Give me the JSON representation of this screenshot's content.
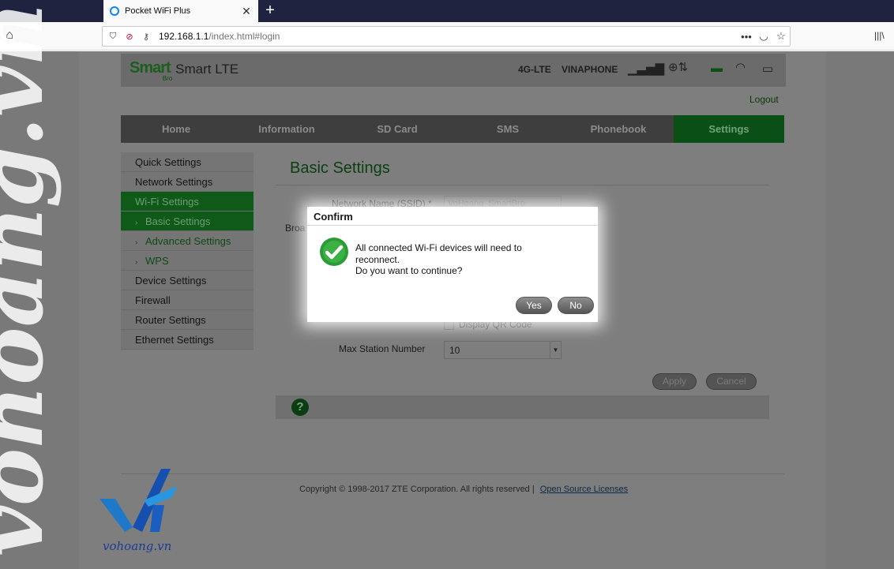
{
  "browser": {
    "tab_title": "Pocket WiFi Plus",
    "new_tab": "+",
    "tab_close": "✕",
    "url_host": "192.168.1.1",
    "url_path": "/index.html#login",
    "page_actions": "•••"
  },
  "header": {
    "brand": "Smart",
    "brand_sub": "Bro",
    "product": "Smart LTE",
    "network_type": "4G-LTE",
    "carrier": "VINAPHONE"
  },
  "logout": "Logout",
  "menu": [
    "Home",
    "Information",
    "SD Card",
    "SMS",
    "Phonebook",
    "Settings"
  ],
  "sidebar": {
    "items": [
      "Quick Settings",
      "Network Settings",
      "Wi-Fi Settings",
      "Basic Settings",
      "Advanced Settings",
      "WPS",
      "Device Settings",
      "Firewall",
      "Router Settings",
      "Ethernet Settings"
    ],
    "sub_marker": "›"
  },
  "content": {
    "title": "Basic Settings",
    "ssid_label": "Network Name (SSID)",
    "required_mark": "*",
    "ssid_value": "VoHoang_SmartBro",
    "broadcast_label_partial": "Broa",
    "qr_label": "Display QR Code",
    "max_station_label": "Max Station Number",
    "max_station_value": "10",
    "apply": "Apply",
    "cancel": "Cancel",
    "help": "?"
  },
  "footer": {
    "copyright": "Copyright © 1998-2017 ZTE Corporation. All rights reserved  |",
    "link": "Open Source Licenses"
  },
  "dialog": {
    "title": "Confirm",
    "line1": "All connected Wi-Fi devices will need to",
    "line2": "reconnect.",
    "line3": "Do you want to continue?",
    "yes": "Yes",
    "no": "No"
  },
  "watermark": {
    "site": "vohoang.vn",
    "vertical": "vohoang.vn"
  },
  "colors": {
    "accent_green": "#0f5a19",
    "dialog_icon_green": "#2a9c35"
  }
}
